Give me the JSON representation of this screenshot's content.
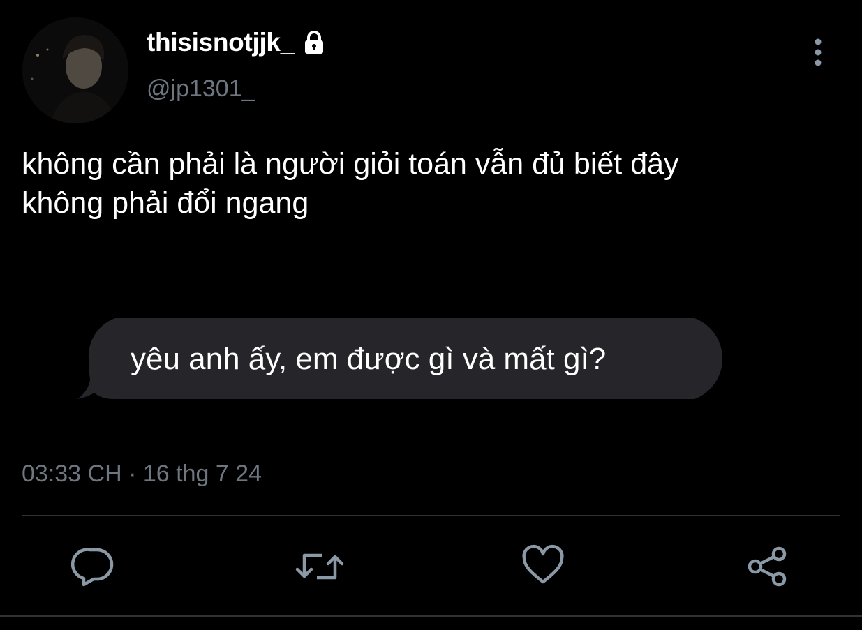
{
  "author": {
    "display_name": "thisisnotjjk_",
    "handle": "@jp1301_",
    "verified_lock_icon": "lock-icon"
  },
  "tweet": {
    "text_lines": [
      "không cần phải là người giỏi toán vẫn đủ biết đây",
      "không phải đổi ngang"
    ],
    "media_bubble_text": "yêu anh ấy, em được gì và mất gì?",
    "timestamp": "03:33 CH · 16 thg 7 24"
  },
  "actions": {
    "reply_icon": "reply-icon",
    "retweet_icon": "retweet-icon",
    "like_icon": "heart-icon",
    "share_icon": "share-icon"
  },
  "colors": {
    "background": "#000000",
    "text": "#ffffff",
    "secondary_text": "#6e7680",
    "icon": "#8b98a5",
    "bubble": "#26252a",
    "divider": "#2f3336"
  }
}
